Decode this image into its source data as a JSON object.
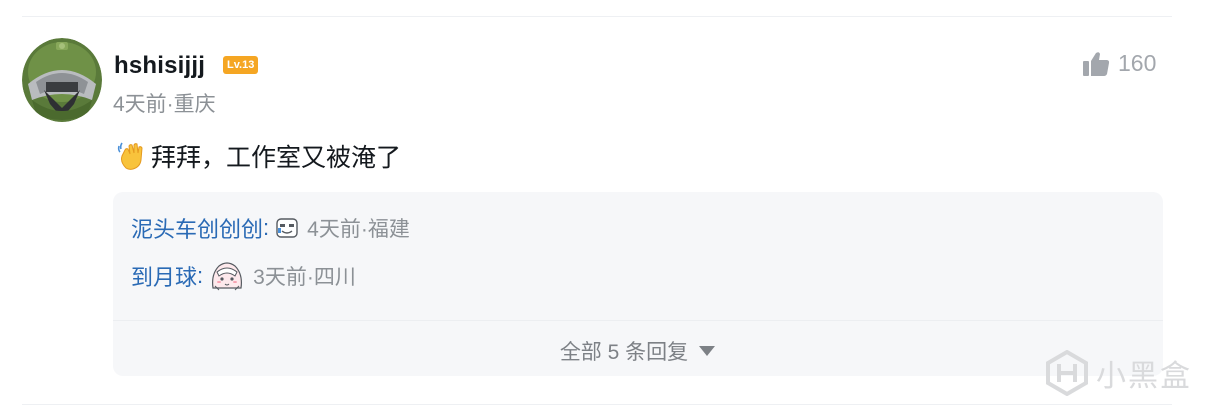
{
  "comment": {
    "username": "hshisijjj",
    "level_badge": "Lv.13",
    "meta": "4天前·重庆",
    "like_count": "160",
    "content_text": "拜拜，工作室又被淹了"
  },
  "replies": [
    {
      "name": "泥头车创创创",
      "colon": ":",
      "meta": "4天前·福建"
    },
    {
      "name": "到月球",
      "colon": ":",
      "meta": "3天前·四川"
    }
  ],
  "expand_label": "全部 5 条回复",
  "watermark": {
    "text": "小黑盒"
  },
  "icons": {
    "like": "thumbs-up-icon",
    "expand": "triangle-down-icon",
    "emoji": "waving-hand-icon"
  },
  "colors": {
    "level_badge": "#f5a623",
    "reply_name": "#2a6ab5",
    "meta": "#8c9196"
  }
}
